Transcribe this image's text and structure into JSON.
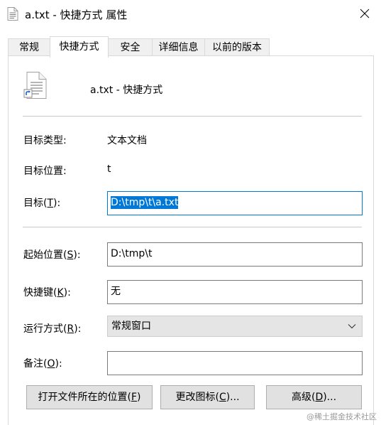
{
  "window": {
    "title": "a.txt - 快捷方式 属性",
    "close_glyph": "✕"
  },
  "tabs": [
    {
      "label": "常规",
      "active": false
    },
    {
      "label": "快捷方式",
      "active": true
    },
    {
      "label": "安全",
      "active": false
    },
    {
      "label": "详细信息",
      "active": false
    },
    {
      "label": "以前的版本",
      "active": false
    }
  ],
  "header": {
    "name": "a.txt - 快捷方式",
    "icon": "shortcut-text-file-icon"
  },
  "fields": {
    "target_type": {
      "label": "目标类型:",
      "value": "文本文档"
    },
    "target_location": {
      "label": "目标位置:",
      "value": "t"
    },
    "target": {
      "label_pre": "目标(",
      "label_key": "T",
      "label_post": "):",
      "value": "D:\\tmp\\t\\a.txt"
    },
    "start_in": {
      "label_pre": "起始位置(",
      "label_key": "S",
      "label_post": "):",
      "value": "D:\\tmp\\t"
    },
    "shortcut_key": {
      "label_pre": "快捷键(",
      "label_key": "K",
      "label_post": "):",
      "value": "无"
    },
    "run": {
      "label_pre": "运行方式(",
      "label_key": "R",
      "label_post": "):",
      "value": "常规窗口"
    },
    "comment": {
      "label_pre": "备注(",
      "label_key": "O",
      "label_post": "):",
      "value": ""
    }
  },
  "buttons": {
    "open_location": {
      "pre": "打开文件所在的位置(",
      "key": "F",
      "post": ")"
    },
    "change_icon": {
      "pre": "更改图标(",
      "key": "C",
      "post": ")..."
    },
    "advanced": {
      "pre": "高级(",
      "key": "D",
      "post": ")..."
    }
  },
  "watermark": "@稀土掘金技术社区",
  "colors": {
    "accent": "#0078d7",
    "button_bg": "#e1e1e1",
    "select_bg": "#e5e5e5"
  }
}
